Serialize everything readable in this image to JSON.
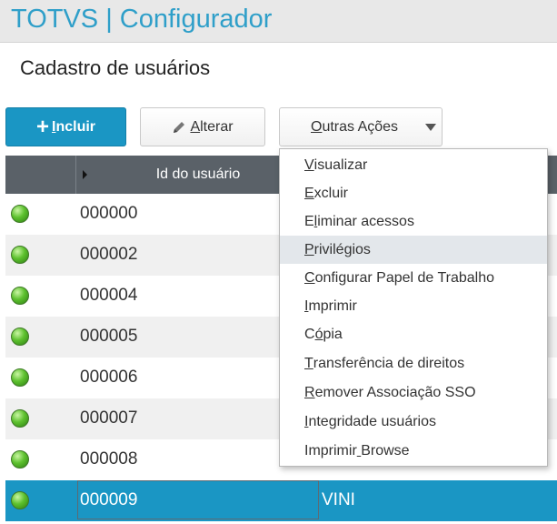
{
  "app": {
    "title": "TOTVS | Configurador"
  },
  "page": {
    "title": "Cadastro de usuários"
  },
  "toolbar": {
    "incluir": {
      "prefix": "",
      "accel": "I",
      "rest": "ncluir"
    },
    "alterar": {
      "accel": "A",
      "rest": "lterar"
    },
    "outras": {
      "accel": "O",
      "rest": "utras Ações"
    }
  },
  "grid": {
    "columns": {
      "id": "Id do usuário",
      "name": ""
    },
    "rows": [
      {
        "id": "000000",
        "name": ""
      },
      {
        "id": "000002",
        "name": ""
      },
      {
        "id": "000004",
        "name": ""
      },
      {
        "id": "000005",
        "name": ""
      },
      {
        "id": "000006",
        "name": ""
      },
      {
        "id": "000007",
        "name": ""
      },
      {
        "id": "000008",
        "name": ""
      },
      {
        "id": "000009",
        "name": "VINI"
      }
    ],
    "selected_row": 7
  },
  "menu": {
    "items": [
      {
        "pre": "",
        "accel": "V",
        "post": "isualizar"
      },
      {
        "pre": "",
        "accel": "E",
        "post": "xcluir"
      },
      {
        "pre": "E",
        "accel": "l",
        "post": "iminar acessos"
      },
      {
        "pre": "",
        "accel": "P",
        "post": "rivilégios"
      },
      {
        "pre": "",
        "accel": "C",
        "post": "onfigurar Papel de Trabalho"
      },
      {
        "pre": "",
        "accel": "I",
        "post": "mprimir"
      },
      {
        "pre": "C",
        "accel": "ó",
        "post": "pia"
      },
      {
        "pre": "",
        "accel": "T",
        "post": "ransferência de direitos"
      },
      {
        "pre": "",
        "accel": "R",
        "post": "emover Associação SSO"
      },
      {
        "pre": "",
        "accel": "I",
        "post": "ntegridade usuários"
      },
      {
        "pre": "Imprimir",
        "accel": " ",
        "post": "Browse"
      }
    ],
    "hovered_index": 3
  },
  "colors": {
    "accent": "#1a96c4",
    "header": "#5a6168",
    "title": "#2f9fc9"
  },
  "icons": {
    "incluir": "plus-icon",
    "alterar": "pencil-icon",
    "outras": "caret-down-icon",
    "status": "status-green-icon"
  }
}
